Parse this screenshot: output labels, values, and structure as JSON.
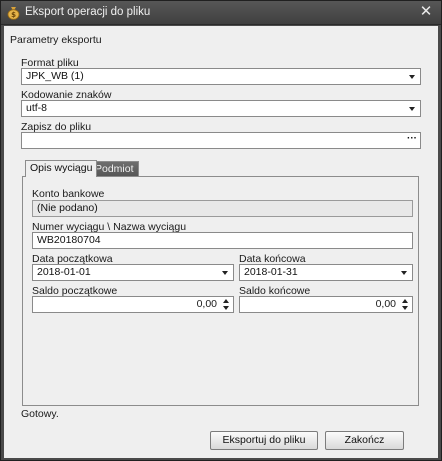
{
  "window": {
    "title": "Eksport operacji do pliku",
    "close_glyph": "✕",
    "icon": "money-bag-icon"
  },
  "params": {
    "section_label": "Parametry eksportu",
    "format_label": "Format pliku",
    "format_value": "JPK_WB (1)",
    "encoding_label": "Kodowanie znaków",
    "encoding_value": "utf-8",
    "save_label": "Zapisz do pliku",
    "save_value": "",
    "browse_glyph": "···"
  },
  "tabs": [
    {
      "label": "Opis wyciągu",
      "active": true
    },
    {
      "label": "Podmiot",
      "active": false
    }
  ],
  "statement": {
    "account_label": "Konto bankowe",
    "account_value": "(Nie podano)",
    "number_label": "Numer wyciągu \\ Nazwa wyciągu",
    "number_value": "WB20180704",
    "start_date_label": "Data początkowa",
    "start_date_value": "2018-01-01",
    "end_date_label": "Data końcowa",
    "end_date_value": "2018-01-31",
    "start_balance_label": "Saldo początkowe",
    "start_balance_value": "0,00",
    "end_balance_label": "Saldo końcowe",
    "end_balance_value": "0,00"
  },
  "status": "Gotowy.",
  "buttons": {
    "export_label": "Eksportuj do pliku",
    "close_label": "Zakończ"
  }
}
